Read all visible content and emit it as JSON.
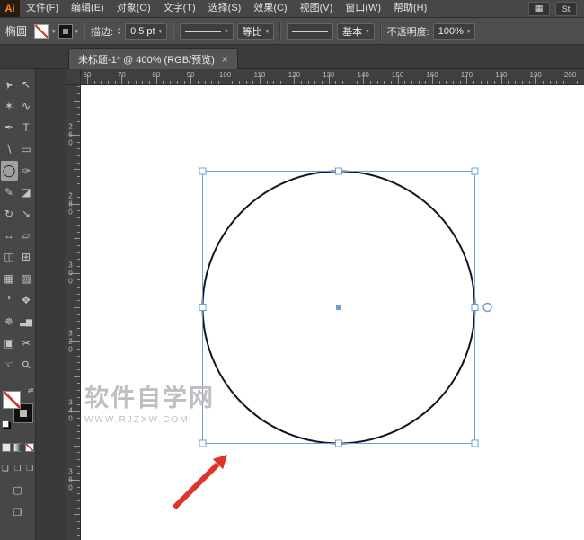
{
  "menubar": {
    "logo": "Ai",
    "items": [
      {
        "id": "file",
        "label": "文件(F)"
      },
      {
        "id": "edit",
        "label": "编辑(E)"
      },
      {
        "id": "object",
        "label": "对象(O)"
      },
      {
        "id": "type",
        "label": "文字(T)"
      },
      {
        "id": "select",
        "label": "选择(S)"
      },
      {
        "id": "effect",
        "label": "效果(C)"
      },
      {
        "id": "view",
        "label": "视图(V)"
      },
      {
        "id": "window",
        "label": "窗口(W)"
      },
      {
        "id": "help",
        "label": "帮助(H)"
      }
    ],
    "right_items": [
      {
        "id": "arrange-documents",
        "label": "▦"
      },
      {
        "id": "stock",
        "label": "St"
      }
    ]
  },
  "controlbar": {
    "tool_label": "椭圆",
    "stroke_label": "描边:",
    "stroke_weight": "0.5 pt",
    "profile_value": "等比",
    "brush_value": "基本",
    "opacity_label": "不透明度:",
    "opacity_value": "100%"
  },
  "icons": {
    "chevron_down": "▾",
    "spinner_up": "▲",
    "spinner_down": "▼"
  },
  "tab": {
    "title": "未标题-1* @ 400% (RGB/预览)",
    "close": "×"
  },
  "rulers": {
    "horizontal_labels": [
      "60",
      "70",
      "80",
      "90",
      "100",
      "110",
      "120",
      "130",
      "140",
      "150",
      "160",
      "170",
      "180",
      "190",
      "200"
    ],
    "vertical_labels": [
      "260",
      "280",
      "300",
      "320",
      "340",
      "360"
    ]
  },
  "toolbar": {
    "rows": [
      [
        {
          "id": "selection",
          "glyph": "➤"
        },
        {
          "id": "direct-selection",
          "glyph": "↖"
        }
      ],
      [
        {
          "id": "magic-wand",
          "glyph": "✶"
        },
        {
          "id": "lasso",
          "glyph": "∿"
        }
      ],
      [
        {
          "id": "pen",
          "glyph": "✒"
        },
        {
          "id": "type",
          "glyph": "T"
        }
      ],
      [
        {
          "id": "line-segment",
          "glyph": "∖"
        },
        {
          "id": "rectangle",
          "glyph": "▭"
        }
      ],
      [
        {
          "id": "ellipse",
          "glyph": "◯",
          "active": true
        },
        {
          "id": "paintbrush",
          "glyph": "✑"
        }
      ],
      [
        {
          "id": "pencil",
          "glyph": "✎"
        },
        {
          "id": "eraser",
          "glyph": "◪"
        }
      ],
      [
        {
          "id": "rotate",
          "glyph": "↻"
        },
        {
          "id": "scale",
          "glyph": "↘"
        }
      ],
      [
        {
          "id": "width",
          "glyph": "↔"
        },
        {
          "id": "free-transform",
          "glyph": "▱"
        }
      ],
      [
        {
          "id": "shape-builder",
          "glyph": "◫"
        },
        {
          "id": "perspective-grid",
          "glyph": "⊞"
        }
      ],
      [
        {
          "id": "mesh",
          "glyph": "▦"
        },
        {
          "id": "gradient",
          "glyph": "▨"
        }
      ],
      [
        {
          "id": "eyedropper",
          "glyph": "❜"
        },
        {
          "id": "blend",
          "glyph": "❖"
        }
      ],
      [
        {
          "id": "symbol-sprayer",
          "glyph": "✵"
        },
        {
          "id": "column-graph",
          "glyph": "▃▆"
        }
      ],
      [
        {
          "id": "artboard",
          "glyph": "▣"
        },
        {
          "id": "slice",
          "glyph": "✂"
        }
      ],
      [
        {
          "id": "hand",
          "glyph": "☜"
        },
        {
          "id": "zoom",
          "glyph": "⚲"
        }
      ]
    ],
    "swap_icon": "⇄",
    "drawing_modes": [
      {
        "id": "draw-normal",
        "glyph": "❏"
      },
      {
        "id": "draw-behind",
        "glyph": "❐"
      },
      {
        "id": "draw-inside",
        "glyph": "❒"
      }
    ],
    "screen_mode_glyph": "▢",
    "extra_glyph": "❐"
  },
  "canvas": {
    "watermark_line1": "软件自学网",
    "watermark_line2": "WWW.RJZXW.COM"
  },
  "colors": {
    "selection": "#6aa2d8",
    "annotation": "#e0342b",
    "circle_stroke": "#15151f"
  }
}
